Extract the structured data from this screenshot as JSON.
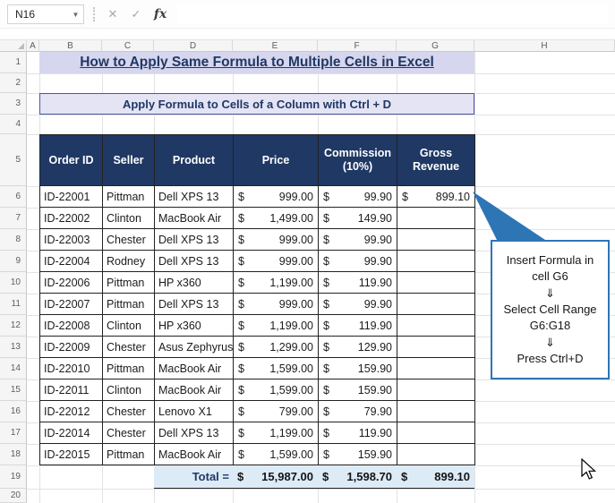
{
  "chrome": {
    "name_box": "N16",
    "cancel_label": "✕",
    "enter_label": "✓",
    "fx_label": "fx"
  },
  "grid": {
    "column_headers": [
      "A",
      "B",
      "C",
      "D",
      "E",
      "F",
      "G",
      "H"
    ],
    "row_headers": [
      "1",
      "2",
      "3",
      "4",
      "5",
      "6",
      "7",
      "8",
      "9",
      "10",
      "11",
      "12",
      "13",
      "14",
      "15",
      "16",
      "17",
      "18",
      "19",
      "20"
    ]
  },
  "banner": {
    "title": "How to Apply Same Formula to Multiple Cells in Excel",
    "subtitle": "Apply Formula to Cells of a Column with Ctrl + D"
  },
  "table": {
    "currency": "$",
    "headers": [
      "Order ID",
      "Seller",
      "Product",
      "Price",
      "Commission (10%)",
      "Gross Revenue"
    ],
    "rows": [
      [
        "ID-22001",
        "Pittman",
        "Dell XPS 13",
        "999.00",
        "99.90",
        "899.10"
      ],
      [
        "ID-22002",
        "Clinton",
        "MacBook Air",
        "1,499.00",
        "149.90",
        ""
      ],
      [
        "ID-22003",
        "Chester",
        "Dell XPS 13",
        "999.00",
        "99.90",
        ""
      ],
      [
        "ID-22004",
        "Rodney",
        "Dell XPS 13",
        "999.00",
        "99.90",
        ""
      ],
      [
        "ID-22006",
        "Pittman",
        "HP x360",
        "1,199.00",
        "119.90",
        ""
      ],
      [
        "ID-22007",
        "Pittman",
        "Dell XPS 13",
        "999.00",
        "99.90",
        ""
      ],
      [
        "ID-22008",
        "Clinton",
        "HP x360",
        "1,199.00",
        "119.90",
        ""
      ],
      [
        "ID-22009",
        "Chester",
        "Asus Zephyrus",
        "1,299.00",
        "129.90",
        ""
      ],
      [
        "ID-22010",
        "Pittman",
        "MacBook Air",
        "1,599.00",
        "159.90",
        ""
      ],
      [
        "ID-22011",
        "Clinton",
        "MacBook Air",
        "1,599.00",
        "159.90",
        ""
      ],
      [
        "ID-22012",
        "Chester",
        "Lenovo X1",
        "799.00",
        "79.90",
        ""
      ],
      [
        "ID-22014",
        "Chester",
        "Dell XPS 13",
        "1,199.00",
        "119.90",
        ""
      ],
      [
        "ID-22015",
        "Pittman",
        "MacBook Air",
        "1,599.00",
        "159.90",
        ""
      ]
    ],
    "total": {
      "label": "Total =",
      "price": "15,987.00",
      "commission": "1,598.70",
      "gross": "899.10"
    }
  },
  "callout": {
    "lines": [
      "Insert Formula in",
      "cell G6",
      "⇓",
      "Select Cell Range",
      "G6:G18",
      "⇓",
      "Press Ctrl+D"
    ]
  },
  "colors": {
    "navy": "#1F3864",
    "title_bg": "#D6D6EE",
    "subtitle_bg": "#E4E4F5",
    "subtitle_border": "#4A55A8",
    "total_bg": "#DDEBF7",
    "callout_border": "#2E75B6",
    "gridline": "#E2E2E2",
    "cell_border": "#222222"
  }
}
